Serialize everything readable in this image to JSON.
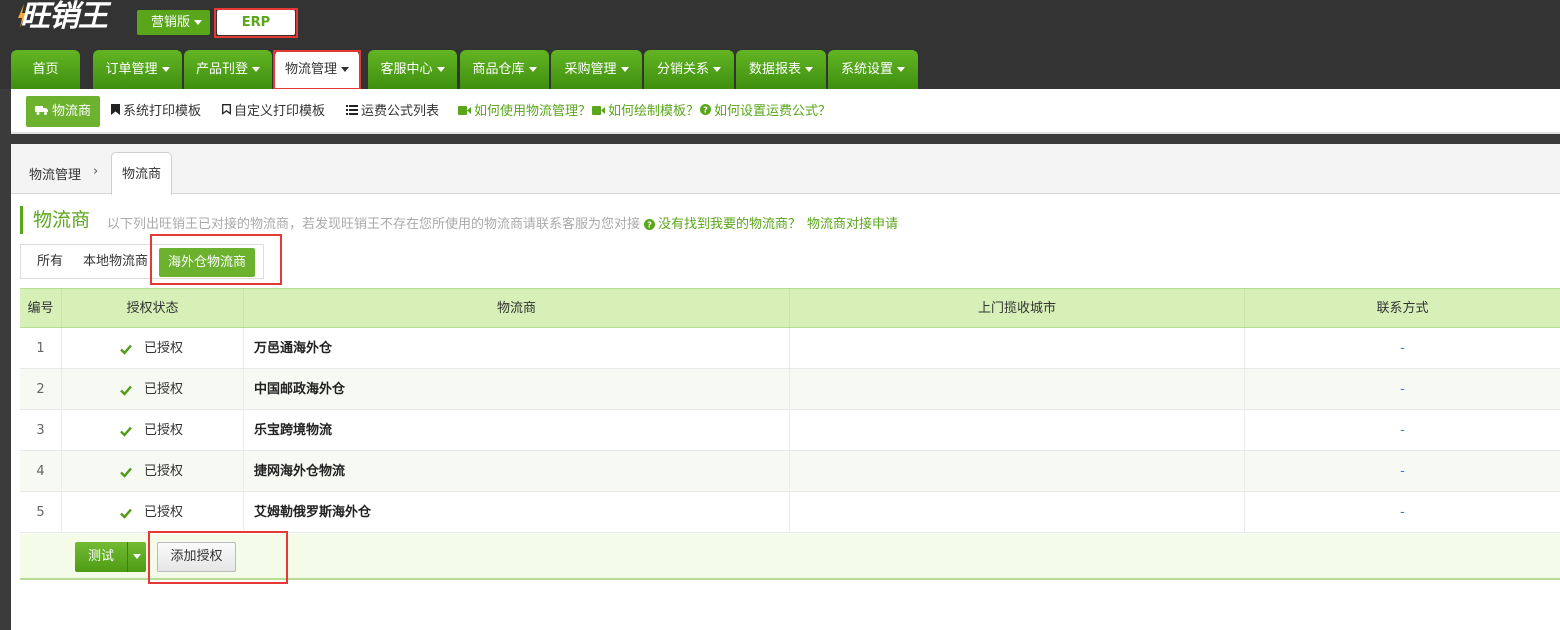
{
  "header": {
    "logo_text": "旺销王",
    "edition_label": "营销版",
    "erp_label": "ERP"
  },
  "nav": {
    "tabs": [
      {
        "label": "首页",
        "dropdown": false
      },
      {
        "label": "订单管理",
        "dropdown": true
      },
      {
        "label": "产品刊登",
        "dropdown": true
      },
      {
        "label": "物流管理",
        "dropdown": true,
        "active": true
      },
      {
        "label": "客服中心",
        "dropdown": true
      },
      {
        "label": "商品仓库",
        "dropdown": true
      },
      {
        "label": "采购管理",
        "dropdown": true
      },
      {
        "label": "分销关系",
        "dropdown": true
      },
      {
        "label": "数据报表",
        "dropdown": true
      },
      {
        "label": "系统设置",
        "dropdown": true
      }
    ]
  },
  "subnav": {
    "items": [
      {
        "label": "物流商",
        "icon": "truck-icon",
        "active": true
      },
      {
        "label": "系统打印模板",
        "icon": "bookmark-icon"
      },
      {
        "label": "自定义打印模板",
        "icon": "bookmark-outline-icon"
      },
      {
        "label": "运费公式列表",
        "icon": "list-icon"
      },
      {
        "label": "如何使用物流管理？",
        "icon": "video-icon",
        "help": true
      },
      {
        "label": "如何绘制模板？",
        "icon": "video-icon",
        "help": true
      },
      {
        "label": "如何设置运费公式？",
        "icon": "question-icon",
        "help": true
      }
    ]
  },
  "breadcrumb": {
    "parent": "物流管理",
    "separator": "›",
    "current": "物流商"
  },
  "section": {
    "title": "物流商",
    "description": "以下列出旺销王已对接的物流商，若发现旺销王不存在您所使用的物流商请联系客服为您对接",
    "link_not_found": "没有找到我要的物流商？",
    "link_apply": "物流商对接申请"
  },
  "filters": {
    "all": "所有",
    "local": "本地物流商",
    "overseas": "海外仓物流商"
  },
  "table": {
    "headers": {
      "id": "编号",
      "status": "授权状态",
      "carrier": "物流商",
      "pickup_city": "上门揽收城市",
      "contact": "联系方式"
    },
    "rows": [
      {
        "id": "1",
        "status": "已授权",
        "carrier": "万邑通海外仓",
        "pickup_city": "",
        "contact": "-"
      },
      {
        "id": "2",
        "status": "已授权",
        "carrier": "中国邮政海外仓",
        "pickup_city": "",
        "contact": "-"
      },
      {
        "id": "3",
        "status": "已授权",
        "carrier": "乐宝跨境物流",
        "pickup_city": "",
        "contact": "-"
      },
      {
        "id": "4",
        "status": "已授权",
        "carrier": "捷网海外仓物流",
        "pickup_city": "",
        "contact": "-"
      },
      {
        "id": "5",
        "status": "已授权",
        "carrier": "艾姆勒俄罗斯海外仓",
        "pickup_city": "",
        "contact": "-"
      }
    ]
  },
  "footer": {
    "test_label": "测试",
    "add_auth_label": "添加授权"
  },
  "colors": {
    "brand_green": "#5aa61b",
    "header_bg": "#333333",
    "highlight_red": "#e53935",
    "table_header_bg": "#d6f0b8"
  }
}
